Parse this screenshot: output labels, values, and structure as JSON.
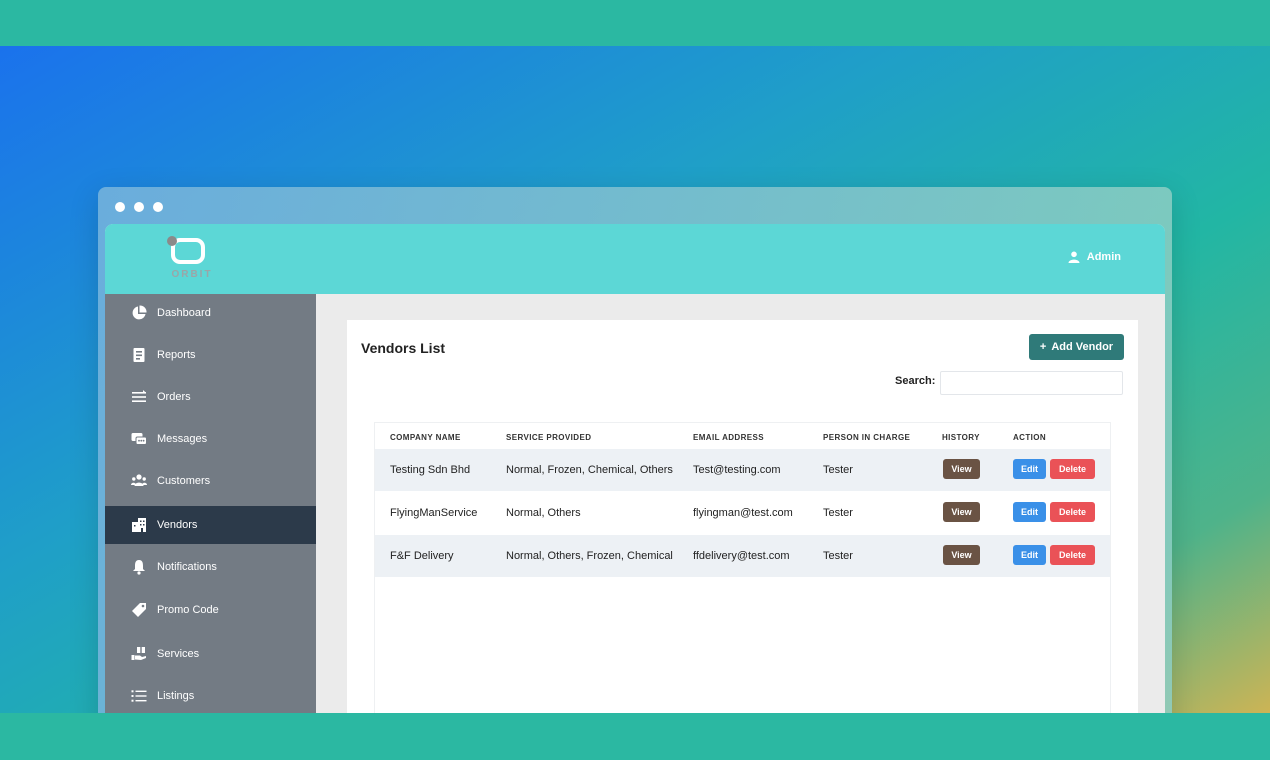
{
  "header": {
    "logo_text": "ORBIT",
    "user_label": "Admin"
  },
  "sidebar": {
    "items": [
      {
        "label": "Dashboard",
        "icon": "pie-chart-icon"
      },
      {
        "label": "Reports",
        "icon": "report-icon"
      },
      {
        "label": "Orders",
        "icon": "orders-icon"
      },
      {
        "label": "Messages",
        "icon": "messages-icon"
      },
      {
        "label": "Customers",
        "icon": "customers-icon"
      },
      {
        "label": "Vendors",
        "icon": "building-icon",
        "active": true
      },
      {
        "label": "Notifications",
        "icon": "bell-icon"
      },
      {
        "label": "Promo Code",
        "icon": "tag-icon"
      },
      {
        "label": "Services",
        "icon": "services-icon"
      },
      {
        "label": "Listings",
        "icon": "list-icon"
      }
    ]
  },
  "main": {
    "title": "Vendors List",
    "add_button": "Add Vendor",
    "search_label": "Search:",
    "search_value": "",
    "table": {
      "columns": [
        "COMPANY NAME",
        "SERVICE PROVIDED",
        "EMAIL ADDRESS",
        "PERSON IN CHARGE",
        "HISTORY",
        "ACTION"
      ],
      "rows": [
        {
          "company": "Testing Sdn Bhd",
          "service": "Normal, Frozen, Chemical, Others",
          "email": "Test@testing.com",
          "person": "Tester",
          "history": "View",
          "edit": "Edit",
          "delete": "Delete"
        },
        {
          "company": "FlyingManService",
          "service": "Normal, Others",
          "email": "flyingman@test.com",
          "person": "Tester",
          "history": "View",
          "edit": "Edit",
          "delete": "Delete"
        },
        {
          "company": "F&F Delivery",
          "service": "Normal, Others, Frozen, Chemical",
          "email": "ffdelivery@test.com",
          "person": "Tester",
          "history": "View",
          "edit": "Edit",
          "delete": "Delete"
        }
      ]
    }
  },
  "colors": {
    "topbar": "#5cd7d6",
    "sidebar": "#737b84",
    "sidebar_active": "#2c3a4a",
    "add_button": "#2f7a79",
    "view_button": "#6a5344",
    "edit_button": "#3a90e8",
    "delete_button": "#ea5257"
  }
}
